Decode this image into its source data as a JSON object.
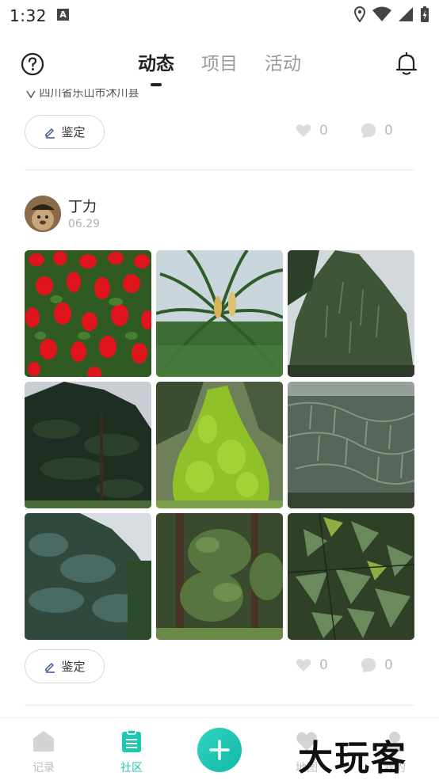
{
  "status_bar": {
    "time": "1:32",
    "icons": [
      "notification-a-icon",
      "location-icon",
      "wifi-icon",
      "signal-icon",
      "battery-icon"
    ]
  },
  "header": {
    "tabs": [
      {
        "label": "动态",
        "active": true
      },
      {
        "label": "项目",
        "active": false
      },
      {
        "label": "活动",
        "active": false
      }
    ]
  },
  "previous_post": {
    "location": "四川省乐山市沐川县",
    "identify_label": "鉴定",
    "likes": "0",
    "comments": "0"
  },
  "post": {
    "user_name": "丁力",
    "date": "06.29",
    "photos": [
      "red-salvia-flowers",
      "cycad-palm",
      "weeping-conifer",
      "dark-fir-tree",
      "golden-cypress",
      "drooping-pine",
      "blue-spruce",
      "ivy-covered-trees",
      "broadleaf-shrub"
    ],
    "identify_label": "鉴定",
    "likes": "0",
    "comments": "0"
  },
  "bottom_nav": {
    "items": [
      {
        "label": "记录",
        "active": false
      },
      {
        "label": "社区",
        "active": true
      },
      {
        "label": "地图",
        "active": false
      },
      {
        "label": "我的",
        "active": false
      }
    ],
    "watermark": "大玩客"
  },
  "colors": {
    "accent": "#1ec8b0",
    "inactive": "#bdbdbd"
  }
}
